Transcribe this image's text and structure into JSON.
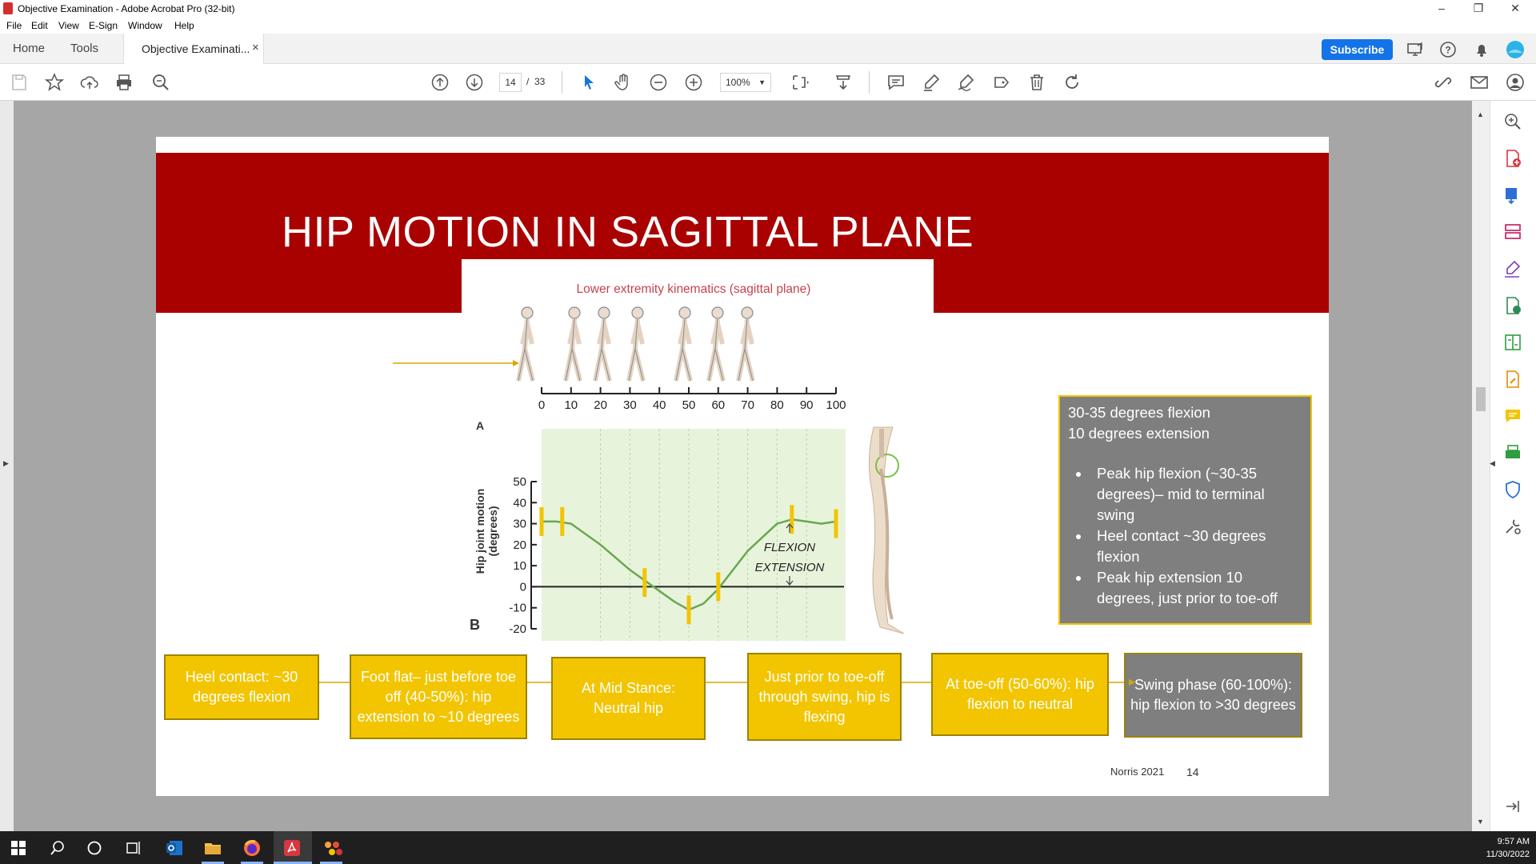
{
  "window": {
    "title": "Objective Examination - Adobe Acrobat Pro (32-bit)",
    "controls": [
      "–",
      "❐",
      "✕"
    ]
  },
  "menu": [
    "File",
    "Edit",
    "View",
    "E-Sign",
    "Window",
    "Help"
  ],
  "tabs": {
    "home": "Home",
    "tools": "Tools",
    "doc": "Objective Examinati...",
    "close": "×"
  },
  "subscribe": "Subscribe",
  "toolbar": {
    "page_current": "14",
    "page_sep": "/",
    "page_total": "33",
    "zoom": "100%"
  },
  "slide": {
    "title": "HIP MOTION IN SAGITTAL PLANE",
    "figure": {
      "caption": "Lower extremity kinematics (sagittal plane)",
      "gait_ticks": [
        "0",
        "10",
        "20",
        "30",
        "40",
        "50",
        "60",
        "70",
        "80",
        "90",
        "100"
      ],
      "label_a": "A",
      "label_b": "B",
      "y_label_1": "Hip joint motion",
      "y_label_2": "(degrees)",
      "y_ticks": [
        "50",
        "40",
        "30",
        "20",
        "10",
        "0",
        "-10",
        "-20"
      ],
      "flexion": "FLEXION",
      "extension": "EXTENSION"
    },
    "note": {
      "line1": "30-35 degrees flexion",
      "line2": "10 degrees extension",
      "bullets": [
        "Peak hip flexion (~30-35 degrees)– mid to terminal swing",
        "Heel contact ~30 degrees flexion",
        "Peak hip extension 10 degrees, just prior to toe-off"
      ]
    },
    "phases": [
      "Heel contact: ~30 degrees flexion",
      "Foot flat– just before toe off (40-50%): hip extension to ~10 degrees",
      "At Mid Stance: Neutral hip",
      "Just prior to toe-off through swing, hip is flexing",
      "At toe-off (50-60%): hip flexion to neutral",
      "Swing phase (60-100%): hip flexion to >30 degrees"
    ],
    "citation": "Norris 2021",
    "page_number": "14"
  },
  "chart_data": {
    "type": "line",
    "title": "",
    "xlabel": "",
    "ylabel": "Hip joint motion (degrees)",
    "x": [
      0,
      5,
      10,
      20,
      30,
      40,
      45,
      50,
      55,
      60,
      70,
      80,
      85,
      90,
      95,
      100
    ],
    "series": [
      {
        "values": [
          31,
          31,
          30,
          20,
          8,
          -2,
          -7,
          -11,
          -8,
          -1,
          17,
          30,
          32,
          31,
          30,
          31
        ]
      }
    ],
    "xlim": [
      0,
      100
    ],
    "ylim": [
      -20,
      50
    ],
    "annotations": [
      "FLEXION",
      "EXTENSION"
    ]
  },
  "colors": {
    "banner": "#a90000",
    "phase_box": "#f2c500",
    "note_box": "#7f7f7f",
    "accent": "#1473e6"
  },
  "taskbar": {
    "time": "9:57 AM",
    "date": "11/30/2022"
  }
}
